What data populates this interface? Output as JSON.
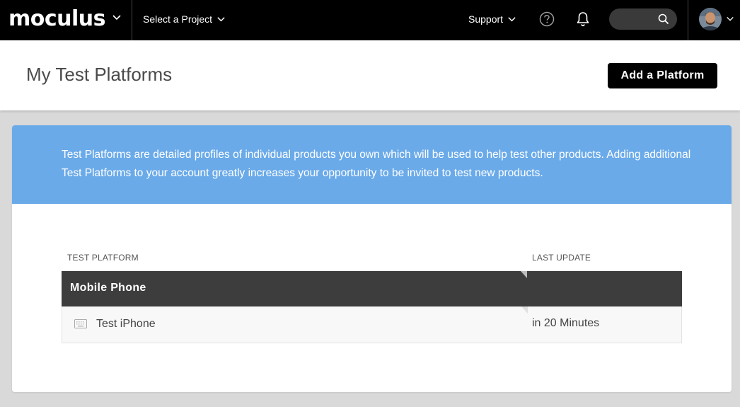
{
  "nav": {
    "logo": "moculus",
    "project_select": "Select a Project",
    "support": "Support",
    "icons": {
      "logo_dropdown": "chevron-down-icon",
      "help": "help-circle-icon",
      "notifications": "bell-icon",
      "search": "search-icon",
      "avatar": "user-avatar",
      "avatar_dropdown": "chevron-down-icon"
    }
  },
  "header": {
    "title": "My Test Platforms",
    "add_button": "Add a Platform"
  },
  "banner": {
    "text": "Test Platforms are detailed profiles of individual products you own which will be used to help test other products. Adding additional Test Platforms to your account greatly increases your opportunity to be invited to test new products."
  },
  "table": {
    "columns": [
      "TEST PLATFORM",
      "LAST UPDATE"
    ],
    "groups": [
      {
        "name": "Mobile Phone",
        "items": [
          {
            "icon": "keyboard-icon",
            "name": "Test iPhone",
            "last_update": "in 20 Minutes"
          }
        ]
      }
    ]
  },
  "colors": {
    "nav_bg": "#000000",
    "banner_bg": "#6aaae9",
    "group_bg": "#3d3d3d",
    "page_bg": "#d9d9d9",
    "button_bg": "#000000"
  }
}
